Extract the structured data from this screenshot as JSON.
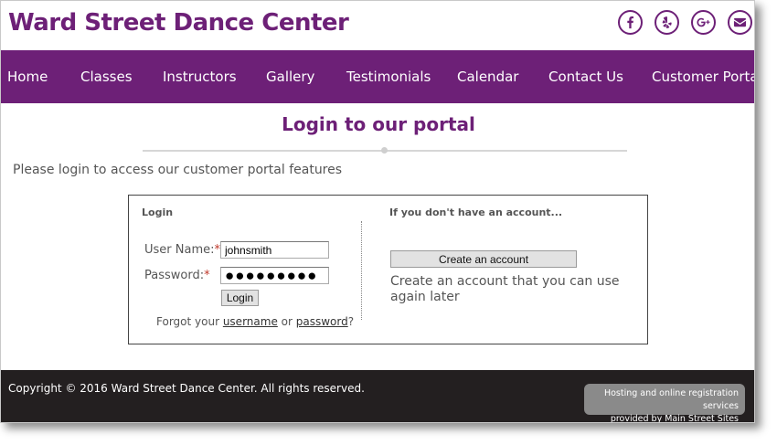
{
  "header": {
    "site_title": "Ward Street Dance Center",
    "social": [
      {
        "name": "facebook-icon"
      },
      {
        "name": "yelp-icon"
      },
      {
        "name": "google-plus-icon"
      },
      {
        "name": "email-icon"
      }
    ]
  },
  "nav": {
    "items": [
      "Home",
      "Classes",
      "Instructors",
      "Gallery",
      "Testimonials",
      "Calendar",
      "Contact Us",
      "Customer Portal"
    ]
  },
  "main": {
    "title": "Login to our portal",
    "intro": "Please login to access our customer portal features",
    "login": {
      "heading": "Login",
      "username_label": "User Name:",
      "username_value": "johnsmith",
      "password_label": "Password:",
      "password_value": "●●●●●●●●●",
      "required_mark": "*",
      "login_button": "Login",
      "forgot_prefix": "Forgot your ",
      "forgot_username": "username",
      "forgot_or": " or ",
      "forgot_password": "password",
      "forgot_suffix": "?"
    },
    "signup": {
      "heading": "If you don't have an account...",
      "create_button": "Create an account",
      "description": "Create an account that you can use again later"
    }
  },
  "footer": {
    "copyright": "Copyright © 2016 Ward Street Dance Center. All rights reserved.",
    "hosting_line1": "Hosting and online registration services",
    "hosting_prefix": "provided by ",
    "hosting_link": "Main Street Sites"
  },
  "colors": {
    "brand": "#6d2077",
    "footer_bg": "#231f20",
    "required": "#c0392b"
  }
}
